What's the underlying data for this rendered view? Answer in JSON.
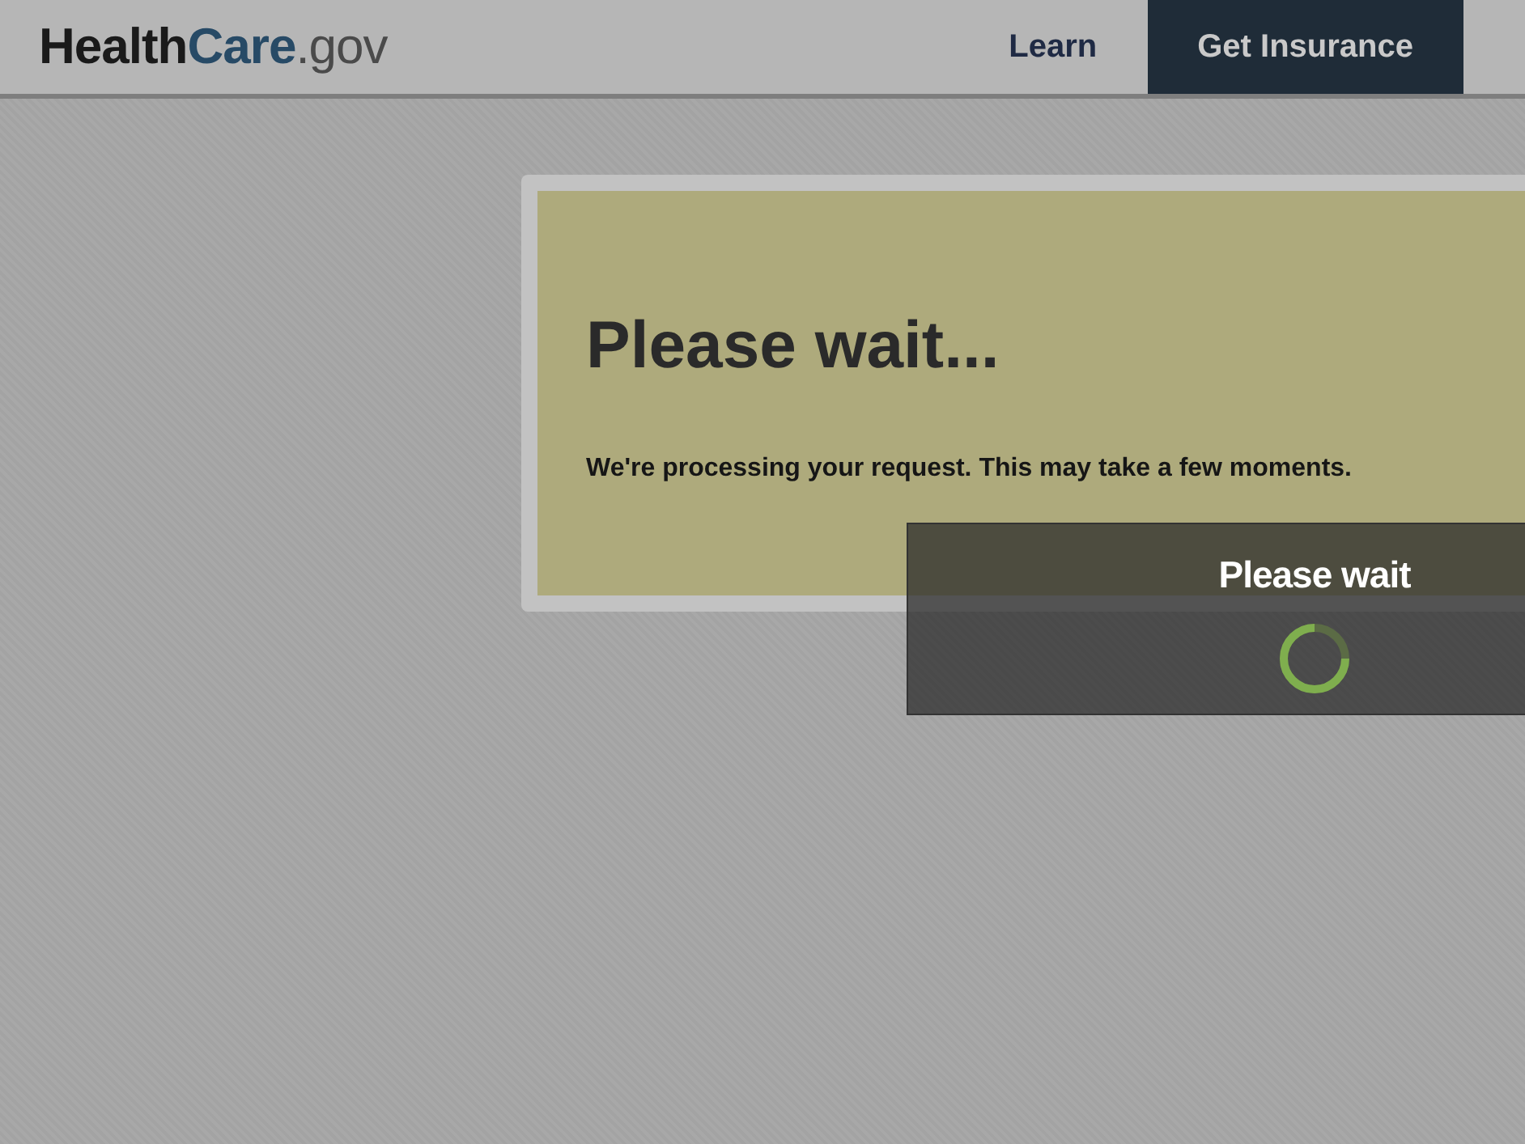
{
  "header": {
    "logo": {
      "parts": [
        "Health",
        "Care",
        ".gov"
      ]
    },
    "nav": [
      {
        "label": "Learn",
        "selected": false
      },
      {
        "label": "Get Insurance",
        "selected": true
      }
    ]
  },
  "message": {
    "title": "Please wait...",
    "text": "We're processing your request. This may take a few moments."
  },
  "overlay": {
    "title": "Please wait"
  }
}
